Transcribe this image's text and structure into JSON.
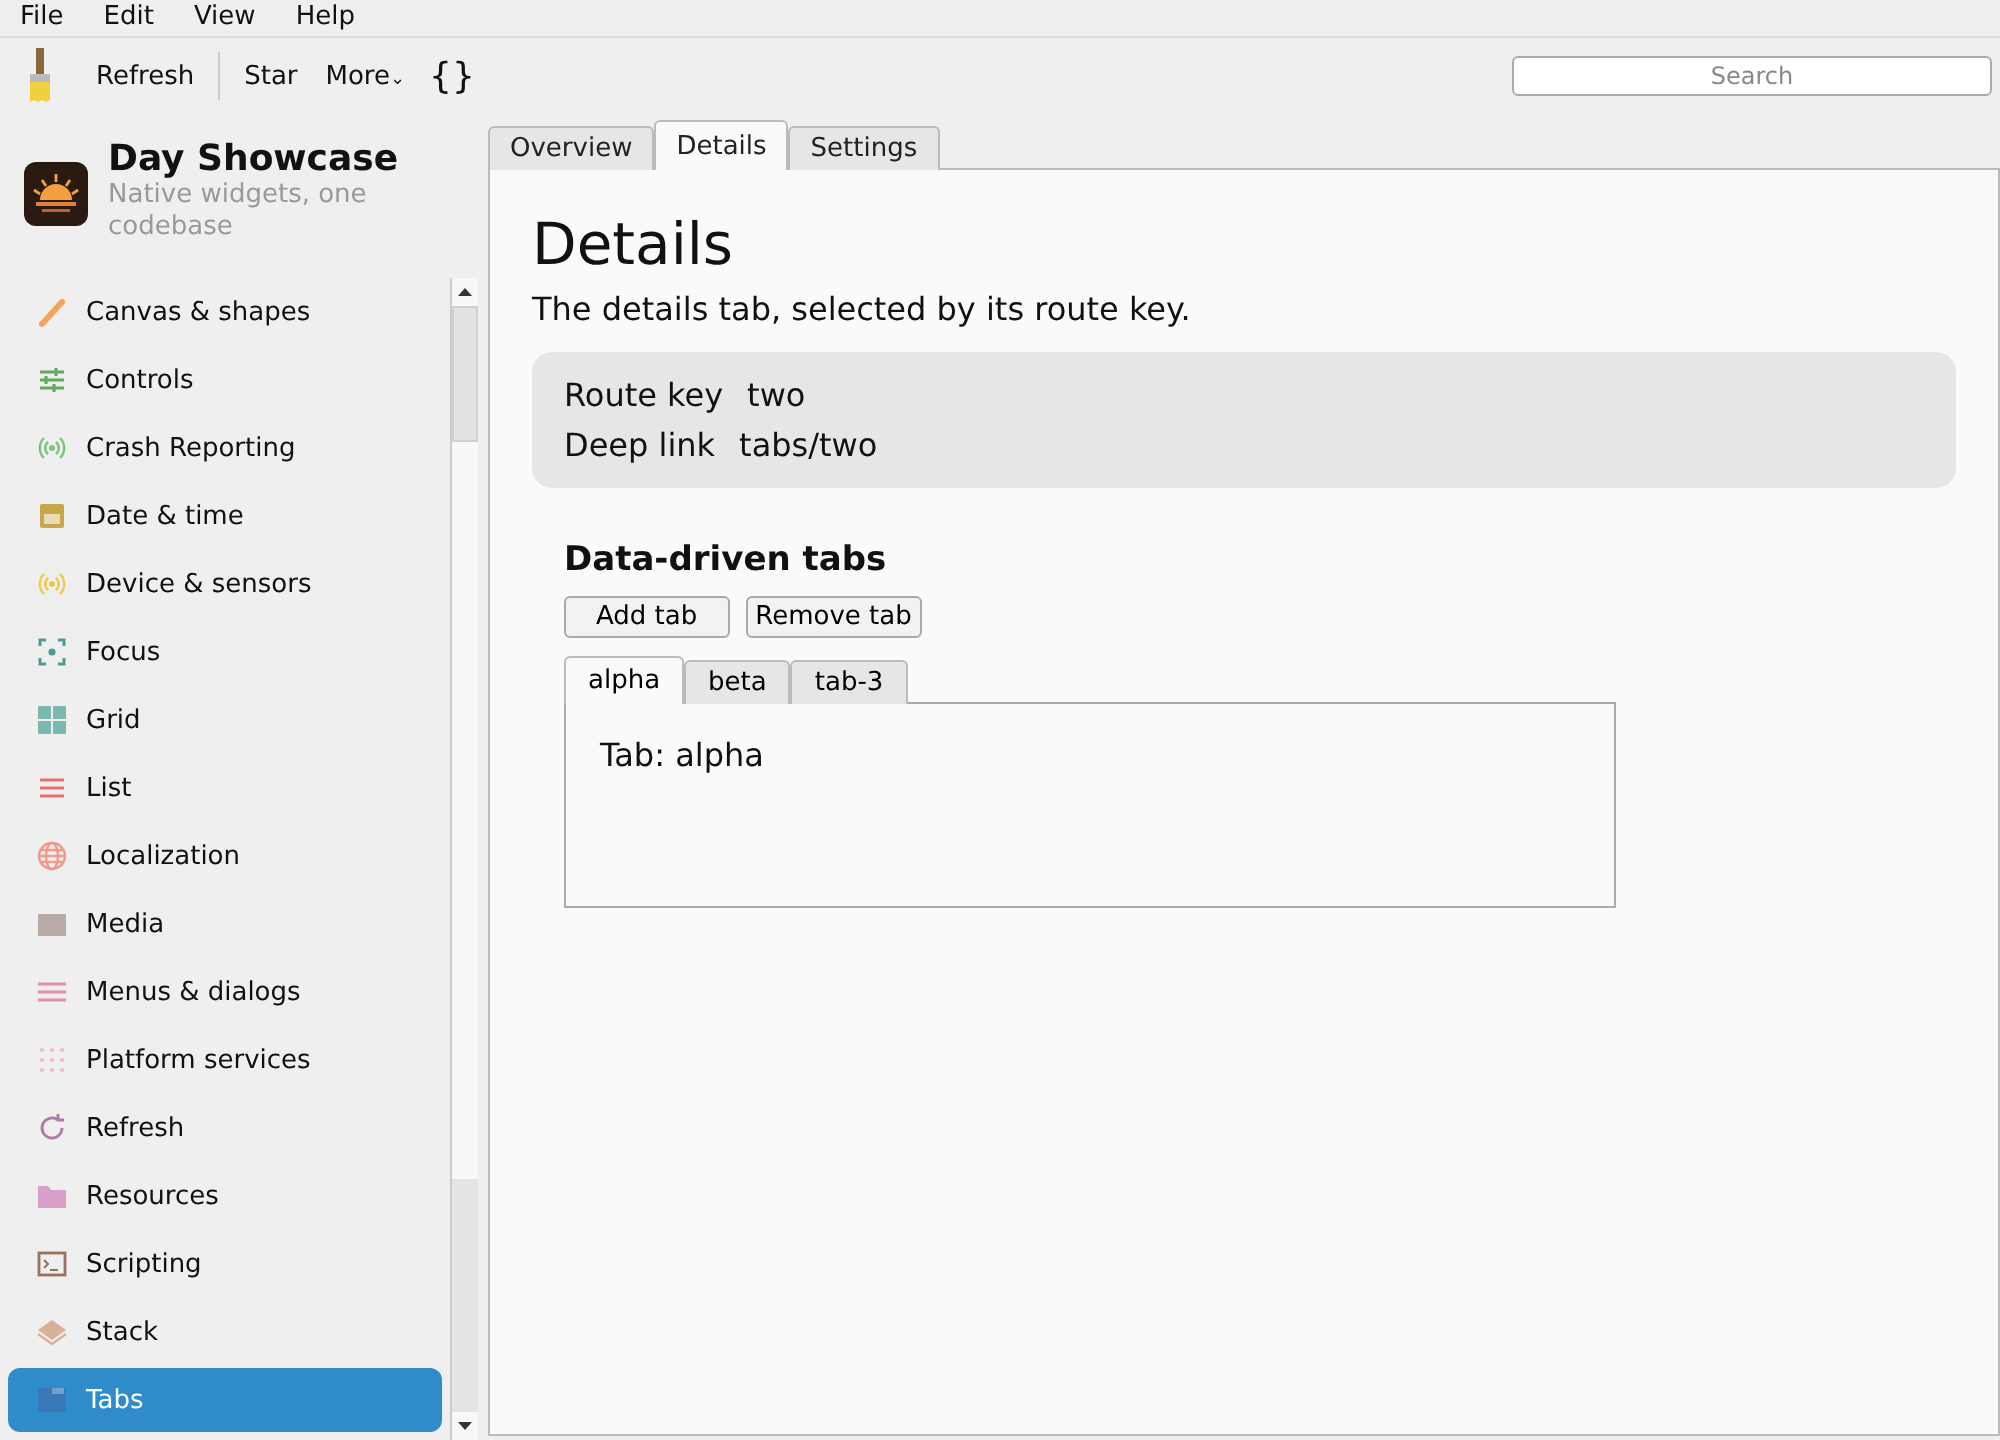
{
  "menu": [
    "File",
    "Edit",
    "View",
    "Help"
  ],
  "toolbar": {
    "buttons": [
      "Refresh",
      "Star",
      "More"
    ],
    "more_caret": "⌄",
    "braces": "{}",
    "search": {
      "placeholder": "Search"
    }
  },
  "app": {
    "title": "Day Showcase",
    "subtitle": "Native widgets, one codebase"
  },
  "sidebar": {
    "items": [
      {
        "label": "Canvas & shapes",
        "selected": false,
        "color": "#f5a55a"
      },
      {
        "label": "Controls",
        "selected": false,
        "color": "#5fa860"
      },
      {
        "label": "Crash Reporting",
        "selected": false,
        "color": "#7cc47a"
      },
      {
        "label": "Date & time",
        "selected": false,
        "color": "#c8a64a"
      },
      {
        "label": "Device & sensors",
        "selected": false,
        "color": "#f0c84a"
      },
      {
        "label": "Focus",
        "selected": false,
        "color": "#4e9a94"
      },
      {
        "label": "Grid",
        "selected": false,
        "color": "#7ab8b0"
      },
      {
        "label": "List",
        "selected": false,
        "color": "#e87070"
      },
      {
        "label": "Localization",
        "selected": false,
        "color": "#f09a8a"
      },
      {
        "label": "Media",
        "selected": false,
        "color": "#b8aaa4"
      },
      {
        "label": "Menus & dialogs",
        "selected": false,
        "color": "#e090a8"
      },
      {
        "label": "Platform services",
        "selected": false,
        "color": "#f0b8c8"
      },
      {
        "label": "Refresh",
        "selected": false,
        "color": "#b07aa8"
      },
      {
        "label": "Resources",
        "selected": false,
        "color": "#d8a0c8"
      },
      {
        "label": "Scripting",
        "selected": false,
        "color": "#9a7060"
      },
      {
        "label": "Stack",
        "selected": false,
        "color": "#d8b098"
      },
      {
        "label": "Tabs",
        "selected": true,
        "color": "#3a78b8"
      }
    ]
  },
  "tabs": [
    {
      "label": "Overview",
      "selected": false
    },
    {
      "label": "Details",
      "selected": true
    },
    {
      "label": "Settings",
      "selected": false
    }
  ],
  "page": {
    "title": "Details",
    "description": "The details tab, selected by its route key.",
    "info": [
      {
        "key": "Route key",
        "value": "two"
      },
      {
        "key": "Deep link",
        "value": "tabs/two"
      }
    ],
    "section": {
      "title": "Data-driven tabs",
      "buttons": [
        "Add tab",
        "Remove tab"
      ],
      "tabs": [
        {
          "label": "alpha",
          "selected": true
        },
        {
          "label": "beta",
          "selected": false
        },
        {
          "label": "tab-3",
          "selected": false
        }
      ],
      "content": "Tab: alpha"
    }
  }
}
